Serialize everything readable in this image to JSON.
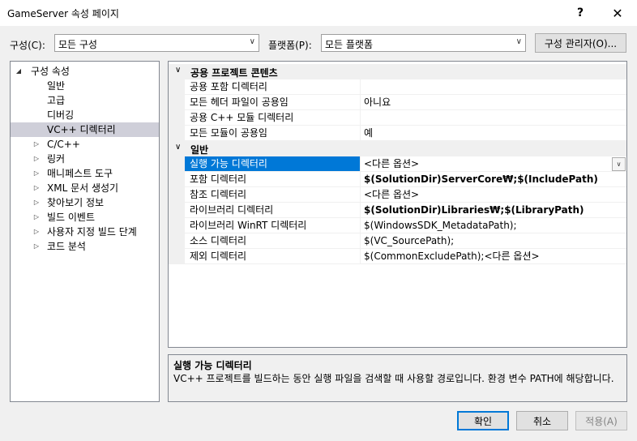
{
  "window": {
    "title": "GameServer 속성 페이지",
    "help": "?",
    "close": "✕"
  },
  "config": {
    "label": "구성(C):",
    "value": "모든 구성"
  },
  "platform": {
    "label": "플랫폼(P):",
    "value": "모든 플랫폼"
  },
  "config_manager": "구성 관리자(O)...",
  "tree": {
    "root": "구성 속성",
    "items": [
      {
        "label": "일반",
        "expandable": false
      },
      {
        "label": "고급",
        "expandable": false
      },
      {
        "label": "디버깅",
        "expandable": false
      },
      {
        "label": "VC++ 디렉터리",
        "expandable": false,
        "selected": true
      },
      {
        "label": "C/C++",
        "expandable": true
      },
      {
        "label": "링커",
        "expandable": true
      },
      {
        "label": "매니페스트 도구",
        "expandable": true
      },
      {
        "label": "XML 문서 생성기",
        "expandable": true
      },
      {
        "label": "찾아보기 정보",
        "expandable": true
      },
      {
        "label": "빌드 이벤트",
        "expandable": true
      },
      {
        "label": "사용자 지정 빌드 단계",
        "expandable": true
      },
      {
        "label": "코드 분석",
        "expandable": true
      }
    ]
  },
  "grid": {
    "cat1": "공용 프로젝트 콘텐츠",
    "cat1_rows": [
      {
        "name": "공용 포함 디렉터리",
        "value": ""
      },
      {
        "name": "모든 헤더 파일이 공용임",
        "value": "아니요"
      },
      {
        "name": "공용 C++ 모듈 디렉터리",
        "value": ""
      },
      {
        "name": "모든 모듈이 공용임",
        "value": "예"
      }
    ],
    "cat2": "일반",
    "cat2_rows": [
      {
        "name": "실행 가능 디렉터리",
        "value": "<다른 옵션>",
        "bold": false
      },
      {
        "name": "포함 디렉터리",
        "value": "$(SolutionDir)ServerCore₩;$(IncludePath)",
        "bold": true
      },
      {
        "name": "참조 디렉터리",
        "value": "<다른 옵션>",
        "bold": false
      },
      {
        "name": "라이브러리 디렉터리",
        "value": "$(SolutionDir)Libraries₩;$(LibraryPath)",
        "bold": true
      },
      {
        "name": "라이브러리 WinRT 디렉터리",
        "value": "$(WindowsSDK_MetadataPath);",
        "bold": false
      },
      {
        "name": "소스 디렉터리",
        "value": "$(VC_SourcePath);",
        "bold": false
      },
      {
        "name": "제외 디렉터리",
        "value": "$(CommonExcludePath);<다른 옵션>",
        "bold": false
      }
    ]
  },
  "description": {
    "title": "실행 가능 디렉터리",
    "text": "VC++ 프로젝트를 빌드하는 동안 실행 파일을 검색할 때 사용할 경로입니다.  환경 변수 PATH에 해당합니다."
  },
  "buttons": {
    "ok": "확인",
    "cancel": "취소",
    "apply": "적용(A)"
  }
}
